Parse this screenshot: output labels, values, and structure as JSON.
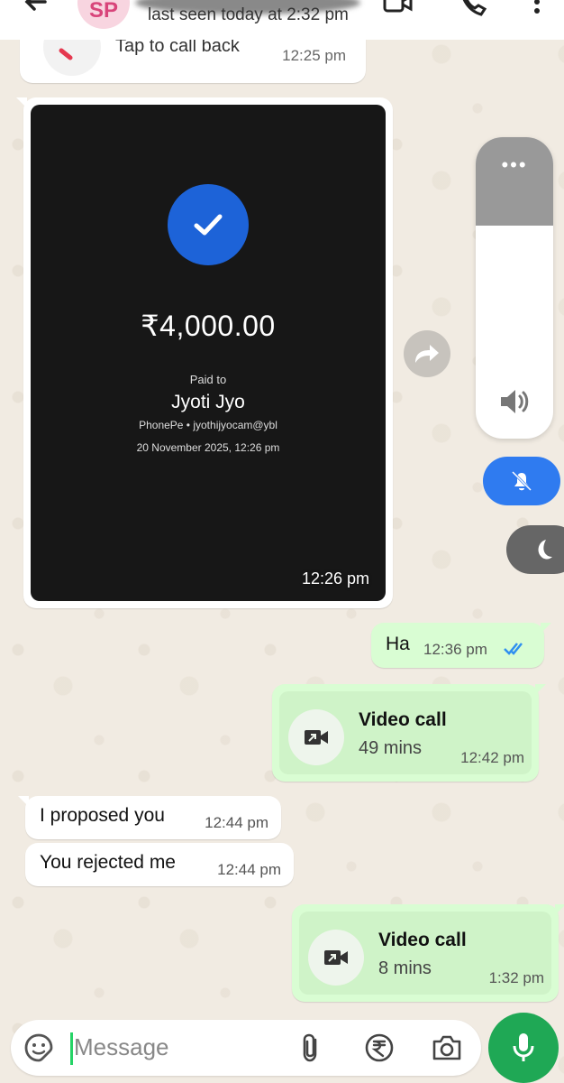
{
  "header": {
    "avatar_initials": "SP",
    "last_seen": "last seen today at 2:32 pm",
    "icons": [
      "back-arrow-icon",
      "video-call-icon",
      "phone-icon",
      "more-vert-icon"
    ]
  },
  "missed_call": {
    "label": "Tap to call back",
    "time": "12:25 pm"
  },
  "payment_image": {
    "amount": "₹4,000.00",
    "paid_to_label": "Paid to",
    "payee": "Jyoti Jyo",
    "payee_details": "PhonePe • jyothijyocam@ybl",
    "date": "20 November 2025, 12:26 pm",
    "time": "12:26 pm"
  },
  "messages": {
    "ha": {
      "text": "Ha",
      "time": "12:36 pm",
      "status": "read"
    },
    "video_call_1": {
      "title": "Video call",
      "duration": "49 mins",
      "time": "12:42 pm"
    },
    "incoming_1": {
      "text": "I proposed you",
      "time": "12:44 pm"
    },
    "incoming_2": {
      "text": "You rejected me",
      "time": "12:44 pm"
    },
    "video_call_2": {
      "title": "Video call",
      "duration": "8 mins",
      "time": "1:32 pm"
    }
  },
  "volume_panel": {
    "dots": "•••",
    "level": 0.7
  },
  "composer": {
    "placeholder": "Message"
  },
  "colors": {
    "outgoing_bubble": "#d9fdd3",
    "mic_button": "#1fa855",
    "mute_button": "#2f7bf0",
    "read_ticks": "#2f8ff0",
    "check_circle": "#1d63d8"
  }
}
